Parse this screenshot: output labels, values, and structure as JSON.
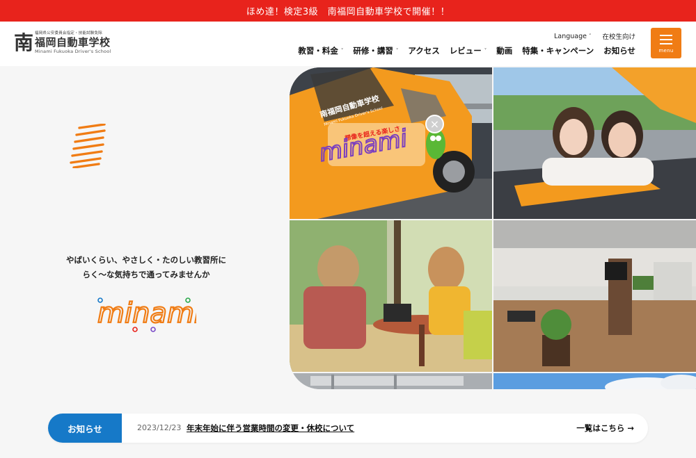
{
  "banner": {
    "text": "ほめ達！検定3級　南福岡自動車学校で開催！！"
  },
  "logo": {
    "mark": "南",
    "small": "福岡県公安委員会指定・技能試験免除",
    "name": "福岡自動車学校",
    "en": "Minami Fukuoka Driver's School"
  },
  "util": {
    "language": "Language",
    "students": "在校生向け"
  },
  "nav": {
    "items": [
      {
        "label": "教習・料金",
        "dropdown": true
      },
      {
        "label": "研修・講習",
        "dropdown": true
      },
      {
        "label": "アクセス",
        "dropdown": false
      },
      {
        "label": "レビュー",
        "dropdown": true
      },
      {
        "label": "動画",
        "dropdown": false
      },
      {
        "label": "特集・キャンペーン",
        "dropdown": false
      },
      {
        "label": "お知らせ",
        "dropdown": false
      }
    ]
  },
  "menu": {
    "label": "menu"
  },
  "hero": {
    "tagline_line1": "やばいくらい、やさしく・たのしい教習所に",
    "tagline_line2": "らく〜な気持ちで通ってみませんか",
    "logo_word": "minami"
  },
  "car": {
    "school": "南福岡自動車学校",
    "school_en": "Minami Fukuoka Driver's School",
    "slogan": "想像を超える楽しさ",
    "brand": "minami"
  },
  "close": {
    "glyph": "×"
  },
  "news": {
    "label": "お知らせ",
    "date": "2023/12/23",
    "title": "年末年始に伴う営業時間の変更・休校について",
    "more": "一覧はこちら →"
  },
  "colors": {
    "banner": "#e8231c",
    "accent": "#f07c14",
    "news_label": "#1679c8"
  }
}
